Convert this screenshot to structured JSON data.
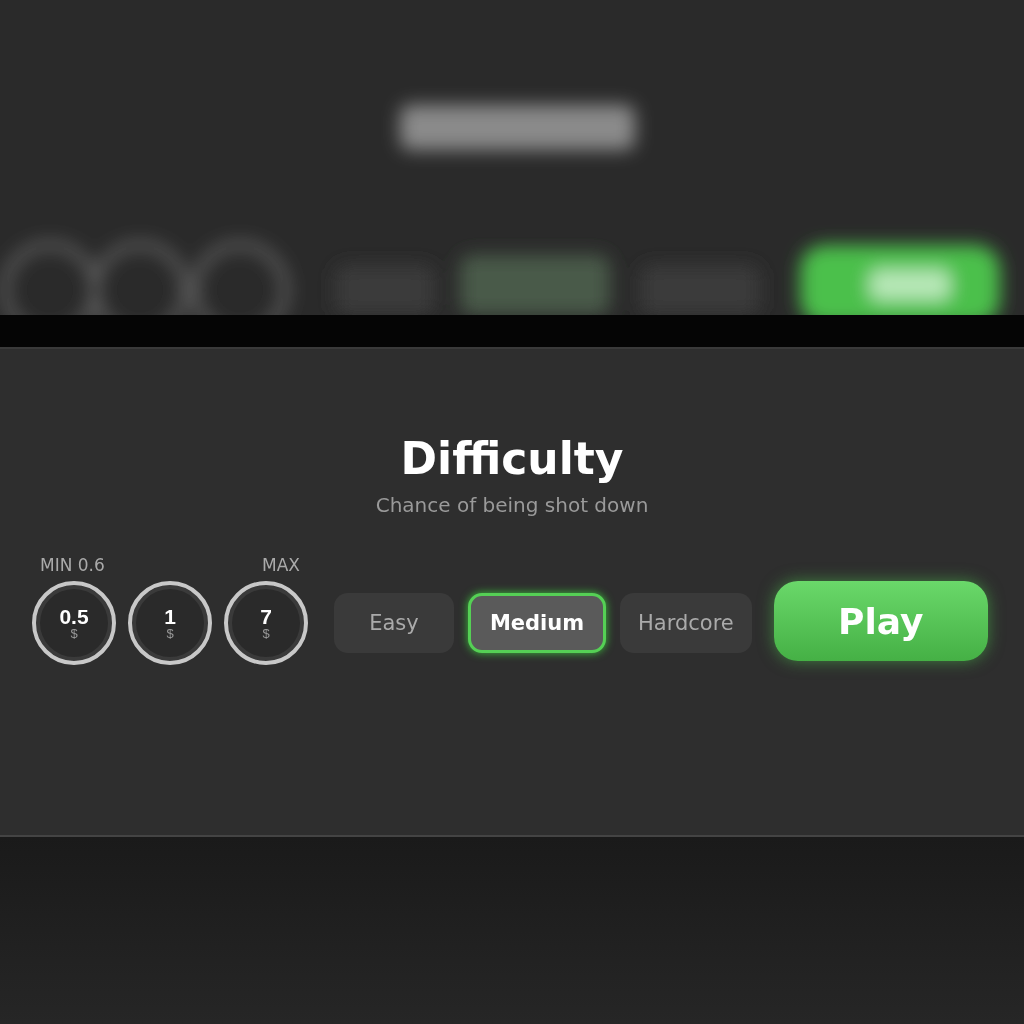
{
  "panel": {
    "title": "Difficulty",
    "subtitle": "Chance of being shot down"
  },
  "bet_limits": {
    "min": "MIN 0.6",
    "max": "MAX"
  },
  "bets": [
    {
      "amount": "0.5",
      "currency": "$"
    },
    {
      "amount": "1",
      "currency": "$"
    },
    {
      "amount": "7",
      "currency": "$"
    }
  ],
  "difficulties": [
    {
      "label": "Easy",
      "selected": false
    },
    {
      "label": "Medium",
      "selected": true
    },
    {
      "label": "Hardcore",
      "selected": false
    }
  ],
  "play_button": "Play"
}
